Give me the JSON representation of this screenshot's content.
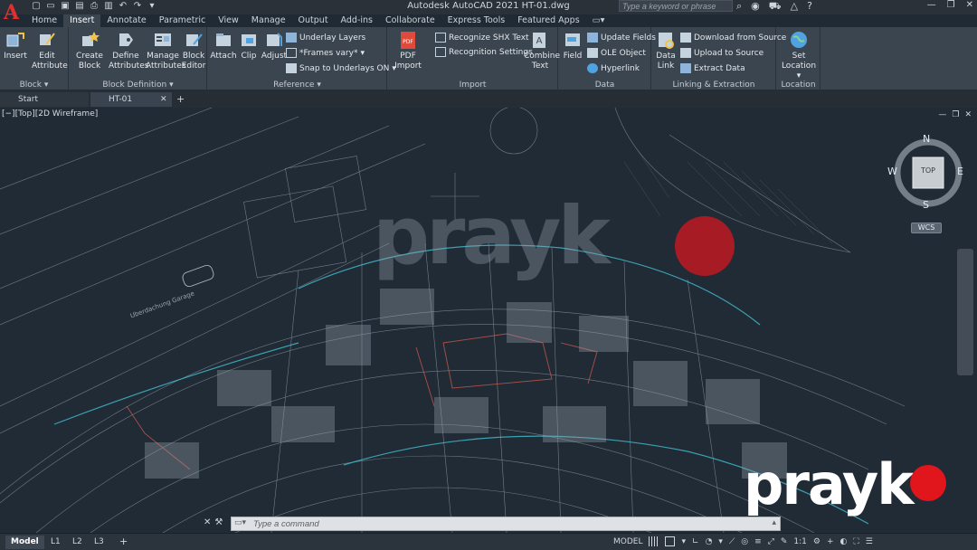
{
  "titlebar": {
    "app_letter": "A",
    "title": "Autodesk AutoCAD 2021    HT-01.dwg",
    "search_placeholder": "Type a keyword or phrase",
    "qat_icons": [
      "new-icon",
      "open-icon",
      "save-icon",
      "save-as-icon",
      "print-icon",
      "undo-icon",
      "redo-icon",
      "dropdown-icon"
    ]
  },
  "tabs": [
    "Home",
    "Insert",
    "Annotate",
    "Parametric",
    "View",
    "Manage",
    "Output",
    "Add-ins",
    "Collaborate",
    "Express Tools",
    "Featured Apps"
  ],
  "active_tab": "Insert",
  "ribbon": {
    "block": {
      "title": "Block",
      "insert": "Insert",
      "edit_attribute": [
        "Edit",
        "Attribute"
      ]
    },
    "block_definition": {
      "title": "Block Definition",
      "create_block": [
        "Create",
        "Block"
      ],
      "define_attributes": [
        "Define",
        "Attributes"
      ],
      "manage_attributes": [
        "Manage",
        "Attributes"
      ],
      "block_editor": [
        "Block",
        "Editor"
      ]
    },
    "reference": {
      "title": "Reference",
      "attach": "Attach",
      "clip": "Clip",
      "adjust": "Adjust",
      "underlay_layers": "Underlay Layers",
      "frames_vary": "*Frames vary*",
      "snap_to_underlays": "Snap to Underlays ON"
    },
    "import": {
      "title": "Import",
      "pdf_import": [
        "PDF",
        "Import"
      ],
      "recognize_shx": "Recognize SHX Text",
      "recognition_settings": "Recognition Settings",
      "combine_text": [
        "Combine",
        "Text"
      ]
    },
    "data": {
      "title": "Data",
      "field": "Field",
      "update_fields": "Update Fields",
      "ole_object": "OLE Object",
      "hyperlink": "Hyperlink"
    },
    "linking": {
      "title": "Linking & Extraction",
      "data_link": [
        "Data",
        "Link"
      ],
      "download_from_source": "Download from Source",
      "upload_to_source": "Upload to Source",
      "extract_data": "Extract  Data"
    },
    "location": {
      "title": "Location",
      "set_location": [
        "Set",
        "Location"
      ]
    }
  },
  "doctabs": {
    "start": "Start",
    "file": "HT-01"
  },
  "viewport": {
    "label": "[−][Top][2D Wireframe]",
    "compass": {
      "n": "N",
      "s": "S",
      "e": "E",
      "w": "W",
      "face": "TOP"
    },
    "wcs": "WCS"
  },
  "drawing_text": {
    "street": "Uberdachung Garage",
    "watermark": "prayk"
  },
  "command": {
    "placeholder": "Type a command"
  },
  "brand": {
    "text": "prayk",
    "dot_color": "#e0161c"
  },
  "statusbar": {
    "layouts": [
      "Model",
      "L1",
      "L2",
      "L3"
    ],
    "model": "MODEL",
    "scale": "1:1"
  },
  "colors": {
    "accent": "#e03030",
    "ribbon": "#3b4550",
    "drawing_bg": "#212b36",
    "cyan_lines": "#3fb7c9",
    "red_lines": "#c4574c"
  }
}
